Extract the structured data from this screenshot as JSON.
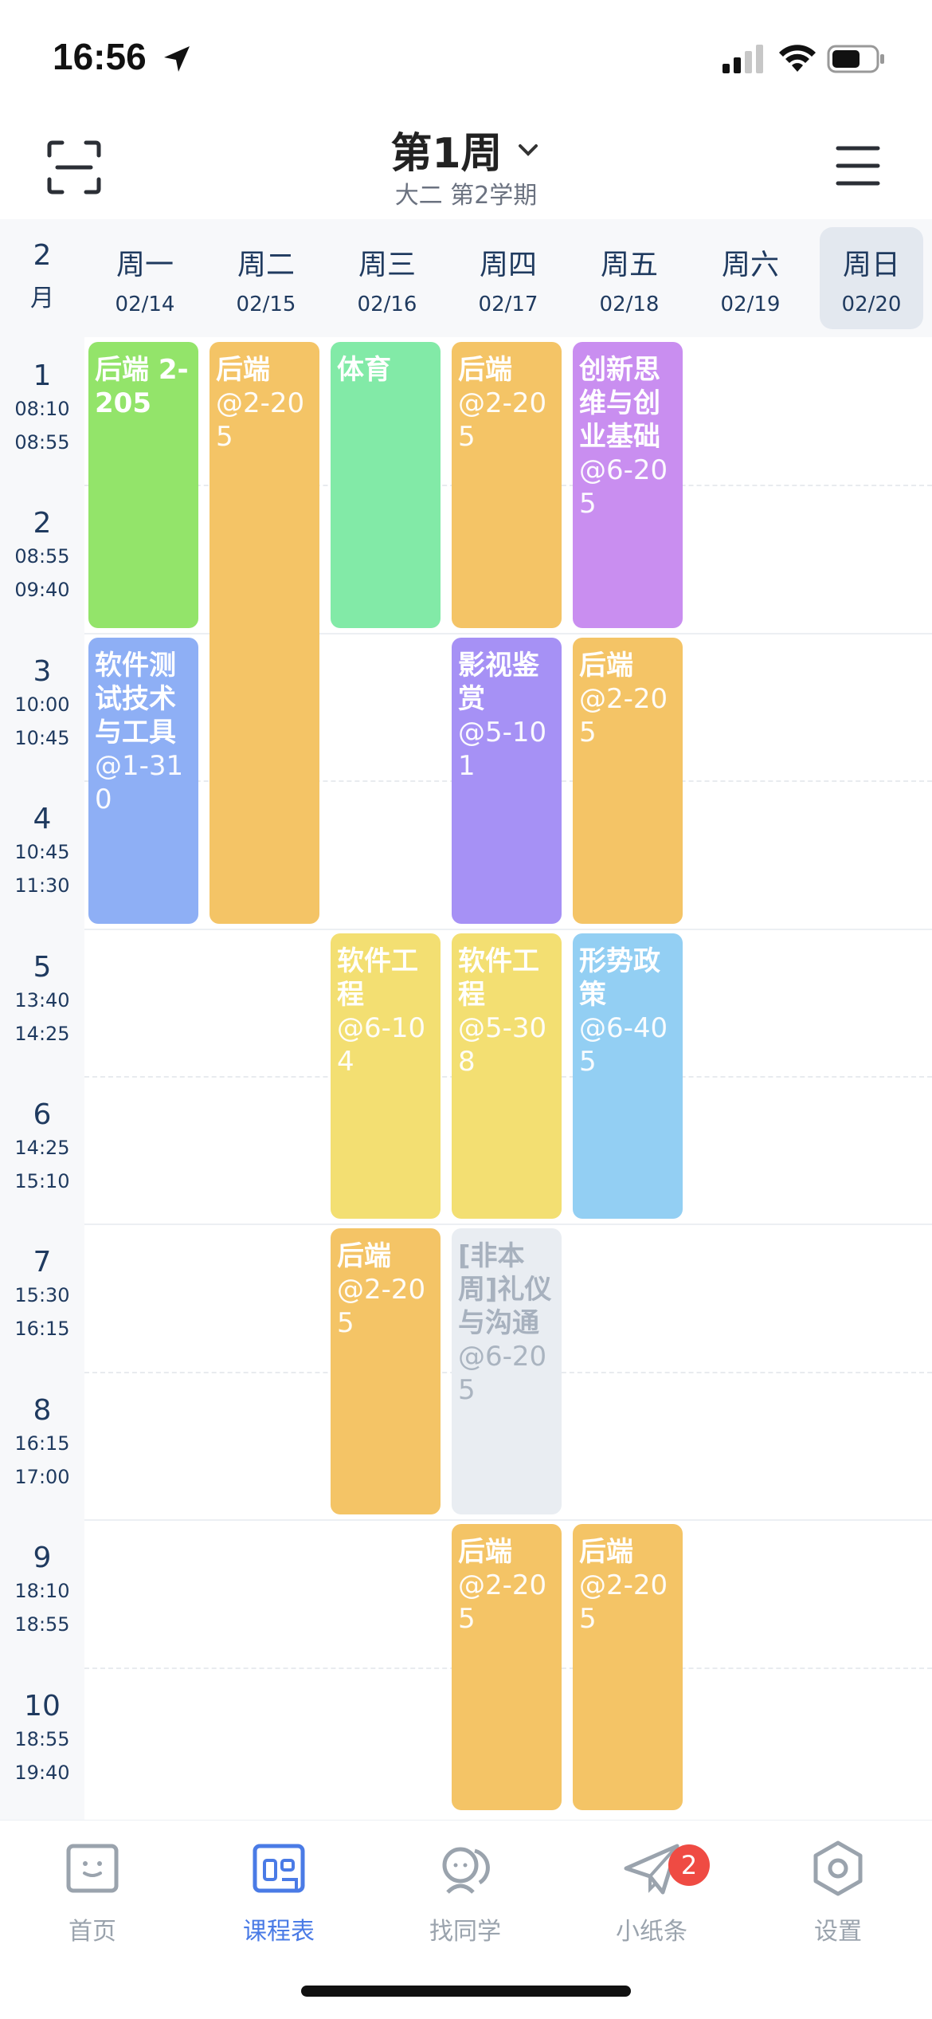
{
  "status_bar": {
    "time": "16:56"
  },
  "header": {
    "week": "第1周",
    "subtitle": "大二 第2学期"
  },
  "month": {
    "num": "2",
    "unit": "月"
  },
  "days": [
    {
      "name": "周一",
      "date": "02/14"
    },
    {
      "name": "周二",
      "date": "02/15"
    },
    {
      "name": "周三",
      "date": "02/16"
    },
    {
      "name": "周四",
      "date": "02/17"
    },
    {
      "name": "周五",
      "date": "02/18"
    },
    {
      "name": "周六",
      "date": "02/19"
    },
    {
      "name": "周日",
      "date": "02/20",
      "today": true
    }
  ],
  "slots": [
    {
      "n": "1",
      "start": "08:10",
      "end": "08:55"
    },
    {
      "n": "2",
      "start": "08:55",
      "end": "09:40"
    },
    {
      "n": "3",
      "start": "10:00",
      "end": "10:45"
    },
    {
      "n": "4",
      "start": "10:45",
      "end": "11:30"
    },
    {
      "n": "5",
      "start": "13:40",
      "end": "14:25"
    },
    {
      "n": "6",
      "start": "14:25",
      "end": "15:10"
    },
    {
      "n": "7",
      "start": "15:30",
      "end": "16:15"
    },
    {
      "n": "8",
      "start": "16:15",
      "end": "17:00"
    },
    {
      "n": "9",
      "start": "18:10",
      "end": "18:55"
    },
    {
      "n": "10",
      "start": "18:55",
      "end": "19:40"
    }
  ],
  "courses": [
    {
      "day": 0,
      "start": 1,
      "span": 2,
      "name": "后端 2-205",
      "loc": "",
      "color": "#93e46a"
    },
    {
      "day": 0,
      "start": 3,
      "span": 2,
      "name": "软件测试技术与工具",
      "loc": "@1-310",
      "color": "#8eaff5"
    },
    {
      "day": 1,
      "start": 1,
      "span": 4,
      "name": "后端",
      "loc": "@2-205",
      "color": "#f4c466"
    },
    {
      "day": 2,
      "start": 1,
      "span": 2,
      "name": "体育",
      "loc": "",
      "color": "#82eaa7"
    },
    {
      "day": 2,
      "start": 5,
      "span": 2,
      "name": "软件工程",
      "loc": "@6-104",
      "color": "#f3df72"
    },
    {
      "day": 2,
      "start": 7,
      "span": 2,
      "name": "后端",
      "loc": "@2-205",
      "color": "#f4c466"
    },
    {
      "day": 3,
      "start": 1,
      "span": 2,
      "name": "后端",
      "loc": "@2-205",
      "color": "#f4c466"
    },
    {
      "day": 3,
      "start": 3,
      "span": 2,
      "name": "影视鉴赏",
      "loc": "@5-101",
      "color": "#a691f5"
    },
    {
      "day": 3,
      "start": 5,
      "span": 2,
      "name": "软件工程",
      "loc": "@5-308",
      "color": "#f3df72"
    },
    {
      "day": 3,
      "start": 7,
      "span": 2,
      "name": "[非本周]礼仪与沟通",
      "loc": "@6-205",
      "color": "#e9edf2",
      "ghost": true
    },
    {
      "day": 3,
      "start": 9,
      "span": 2,
      "name": "后端",
      "loc": "@2-205",
      "color": "#f4c466"
    },
    {
      "day": 4,
      "start": 1,
      "span": 2,
      "name": "创新思维与创业基础",
      "loc": "@6-205",
      "color": "#c98ef0"
    },
    {
      "day": 4,
      "start": 3,
      "span": 2,
      "name": "后端",
      "loc": "@2-205",
      "color": "#f4c466"
    },
    {
      "day": 4,
      "start": 5,
      "span": 2,
      "name": "形势政策",
      "loc": "@6-405",
      "color": "#93cff3"
    },
    {
      "day": 4,
      "start": 9,
      "span": 2,
      "name": "后端",
      "loc": "@2-205",
      "color": "#f4c466"
    }
  ],
  "tabs": [
    {
      "label": "首页",
      "icon": "home-face-icon"
    },
    {
      "label": "课程表",
      "icon": "schedule-icon",
      "active": true
    },
    {
      "label": "找同学",
      "icon": "classmates-icon"
    },
    {
      "label": "小纸条",
      "icon": "paper-plane-icon",
      "badge": "2"
    },
    {
      "label": "设置",
      "icon": "settings-hexagon-icon"
    }
  ]
}
